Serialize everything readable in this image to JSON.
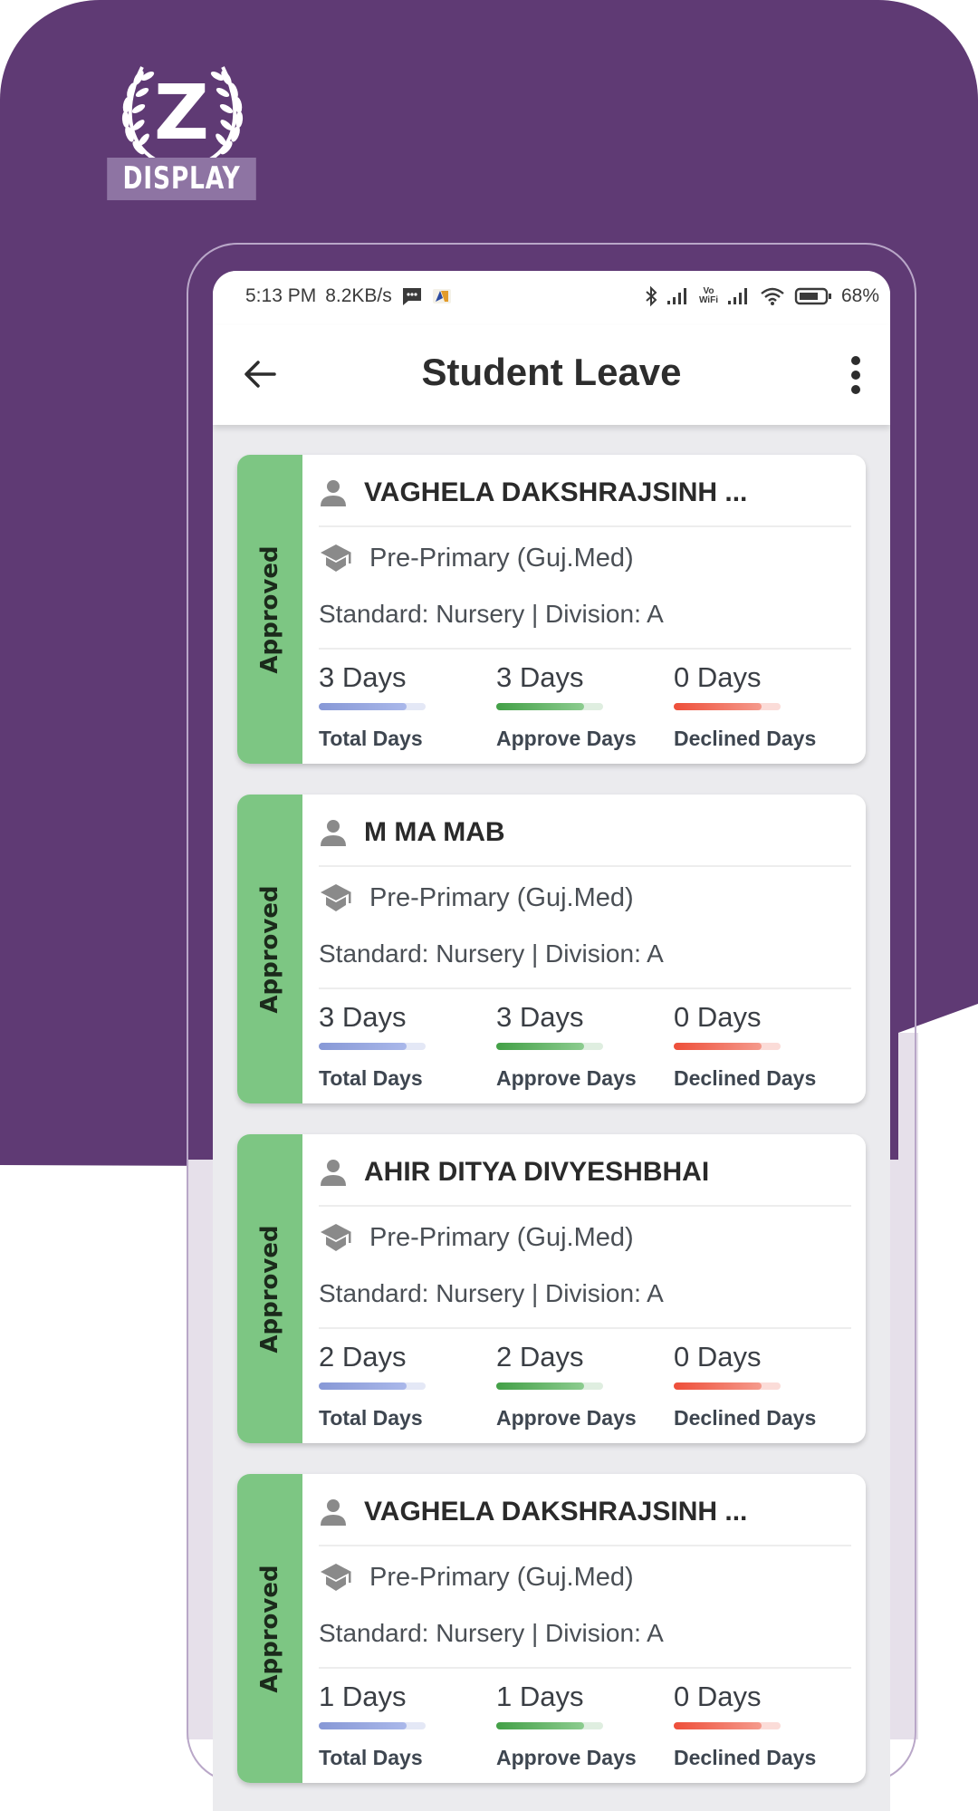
{
  "brand": {
    "logo_letter": "Z",
    "logo_text": "DISPLAY"
  },
  "colors": {
    "background_purple": "#5f3a74",
    "approved_green": "#7dc683",
    "total_bar": "#8b9ddb",
    "approve_bar": "#4caf50",
    "declined_bar": "#ef5a45"
  },
  "status_bar": {
    "time": "5:13 PM",
    "network_speed": "8.2KB/s",
    "battery": "68%",
    "icons": [
      "message-icon",
      "app-notification-icon",
      "bluetooth-icon",
      "signal-icon",
      "vowifi-icon",
      "signal-icon",
      "wifi-icon",
      "battery-icon"
    ],
    "vowifi_label_top": "Vo",
    "vowifi_label_bottom": "WiFi"
  },
  "app_bar": {
    "title": "Student Leave",
    "back_icon": "arrow-left-icon",
    "menu_icon": "more-vertical-icon"
  },
  "cards": [
    {
      "status": "Approved",
      "name": "VAGHELA DAKSHRAJSINH ...",
      "school": "Pre-Primary (Guj.Med)",
      "standard_line": "Standard: Nursery | Division: A",
      "total": {
        "value": "3 Days",
        "label": "Total Days",
        "fill": 0.82
      },
      "approve": {
        "value": "3 Days",
        "label": "Approve Days",
        "fill": 0.82
      },
      "declined": {
        "value": "0 Days",
        "label": "Declined Days",
        "fill": 0.82
      }
    },
    {
      "status": "Approved",
      "name": "M MA MAB",
      "school": "Pre-Primary (Guj.Med)",
      "standard_line": "Standard: Nursery | Division: A",
      "total": {
        "value": "3 Days",
        "label": "Total Days",
        "fill": 0.82
      },
      "approve": {
        "value": "3 Days",
        "label": "Approve Days",
        "fill": 0.82
      },
      "declined": {
        "value": "0 Days",
        "label": "Declined Days",
        "fill": 0.82
      }
    },
    {
      "status": "Approved",
      "name": "AHIR DITYA DIVYESHBHAI",
      "school": "Pre-Primary (Guj.Med)",
      "standard_line": "Standard: Nursery | Division: A",
      "total": {
        "value": "2 Days",
        "label": "Total Days",
        "fill": 0.82
      },
      "approve": {
        "value": "2 Days",
        "label": "Approve Days",
        "fill": 0.82
      },
      "declined": {
        "value": "0 Days",
        "label": "Declined Days",
        "fill": 0.82
      }
    },
    {
      "status": "Approved",
      "name": "VAGHELA DAKSHRAJSINH ...",
      "school": "Pre-Primary (Guj.Med)",
      "standard_line": "Standard: Nursery | Division: A",
      "total": {
        "value": "1 Days",
        "label": "Total Days",
        "fill": 0.82
      },
      "approve": {
        "value": "1 Days",
        "label": "Approve Days",
        "fill": 0.82
      },
      "declined": {
        "value": "0 Days",
        "label": "Declined Days",
        "fill": 0.82
      }
    }
  ]
}
